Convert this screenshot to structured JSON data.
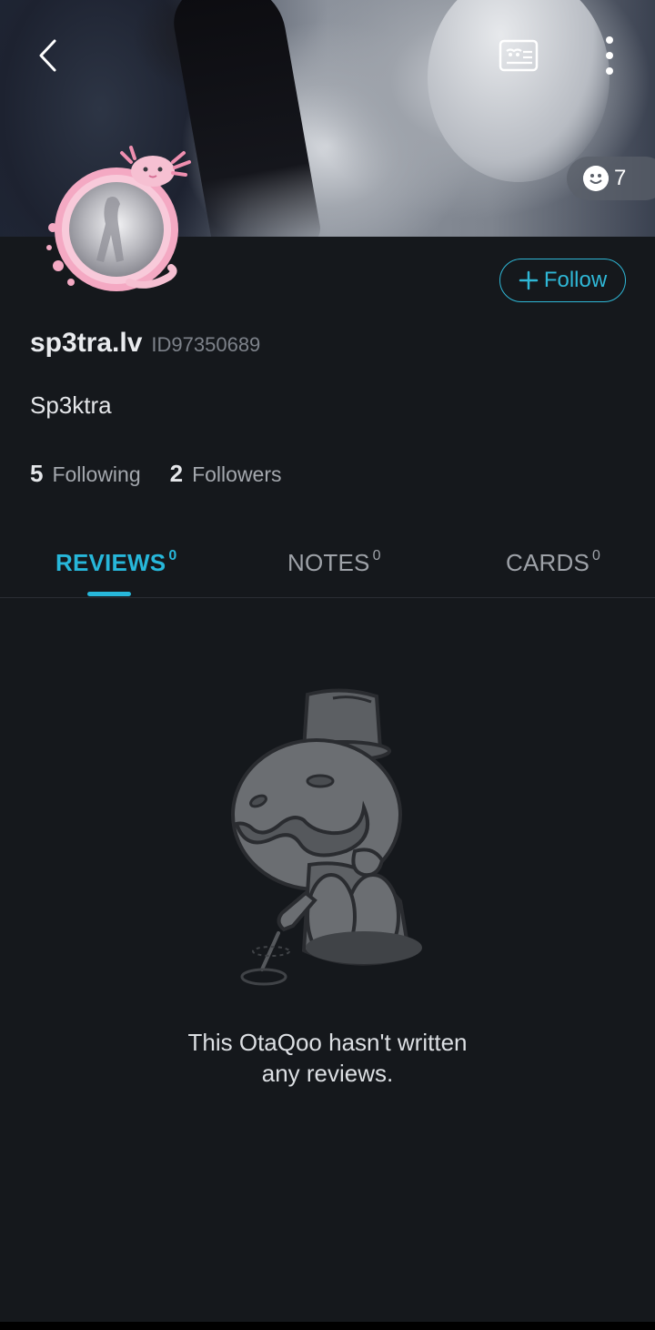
{
  "header": {
    "back_icon": "chevron-left-icon",
    "card_icon": "id-card-icon",
    "more_icon": "more-vertical-icon",
    "reaction_icon": "smiley-icon",
    "reaction_count": "7"
  },
  "profile": {
    "username": "sp3tra.lv",
    "user_id": "ID97350689",
    "bio": "Sp3ktra",
    "follow_label": "Follow",
    "following_count": "5",
    "following_label": "Following",
    "followers_count": "2",
    "followers_label": "Followers"
  },
  "tabs": [
    {
      "label": "REVIEWS",
      "count": "0",
      "active": true
    },
    {
      "label": "NOTES",
      "count": "0",
      "active": false
    },
    {
      "label": "CARDS",
      "count": "0",
      "active": false
    }
  ],
  "empty_state": {
    "line1": "This OtaQoo hasn't written",
    "line2": "any reviews."
  },
  "colors": {
    "accent": "#27b7da",
    "background": "#15181c"
  }
}
